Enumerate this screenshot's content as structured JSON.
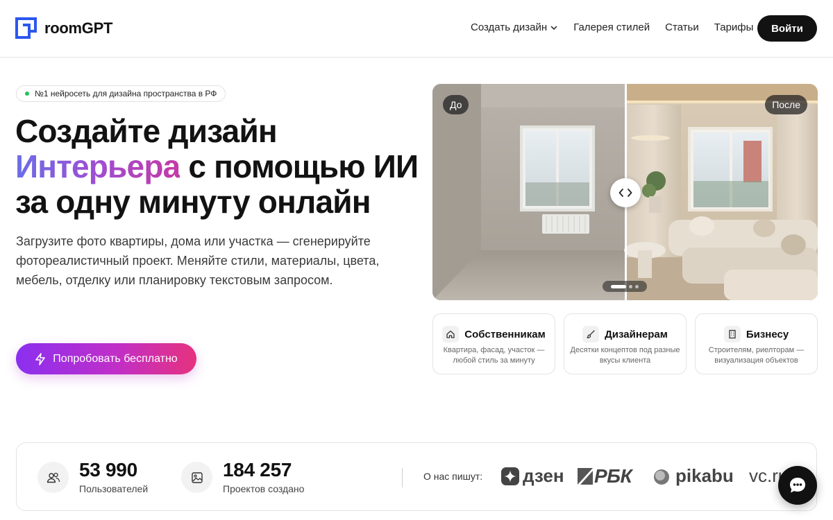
{
  "header": {
    "logo_text": "roomGPT",
    "nav": [
      {
        "label": "Создать дизайн",
        "has_dropdown": true
      },
      {
        "label": "Галерея стилей",
        "has_dropdown": false
      },
      {
        "label": "Статьи",
        "has_dropdown": false
      },
      {
        "label": "Тарифы",
        "has_dropdown": false
      }
    ],
    "login_label": "Войти",
    "brand_color": "#2b57f0"
  },
  "hero": {
    "badge": "№1 нейросеть для дизайна пространства в РФ",
    "title_line1": "Создайте дизайн",
    "title_line2_accent": "Интерьера",
    "title_line2_rest": " с помощью ИИ",
    "title_line3": "за одну минуту онлайн",
    "description": "Загрузите фото квартиры, дома или участка — сгенерируйте фотореалистичный проект. Меняйте стили, материалы, цвета, мебель, отделку или планировку текстовым запросом.",
    "cta_label": "Попробовать бесплатно",
    "cta_icon": "lightning-icon"
  },
  "compare": {
    "before_label": "До",
    "after_label": "После",
    "slides_total": 3,
    "active_slide": 1
  },
  "audience": [
    {
      "title": "Собственникам",
      "subtitle": "Квартира, фасад, участок — любой стиль за минуту",
      "icon": "home-icon"
    },
    {
      "title": "Дизайнерам",
      "subtitle": "Десятки концептов под разные вкусы клиента",
      "icon": "brush-icon"
    },
    {
      "title": "Бизнесу",
      "subtitle": "Строителям, риелторам — визуализация объектов",
      "icon": "building-icon"
    }
  ],
  "stats": {
    "users_value": "53 990",
    "users_label": "Пользователей",
    "projects_value": "184 257",
    "projects_label": "Проектов создано",
    "press_label": "О нас пишут:",
    "press": [
      "дзен",
      "РБК",
      "pikabu",
      "vc.ru"
    ]
  }
}
